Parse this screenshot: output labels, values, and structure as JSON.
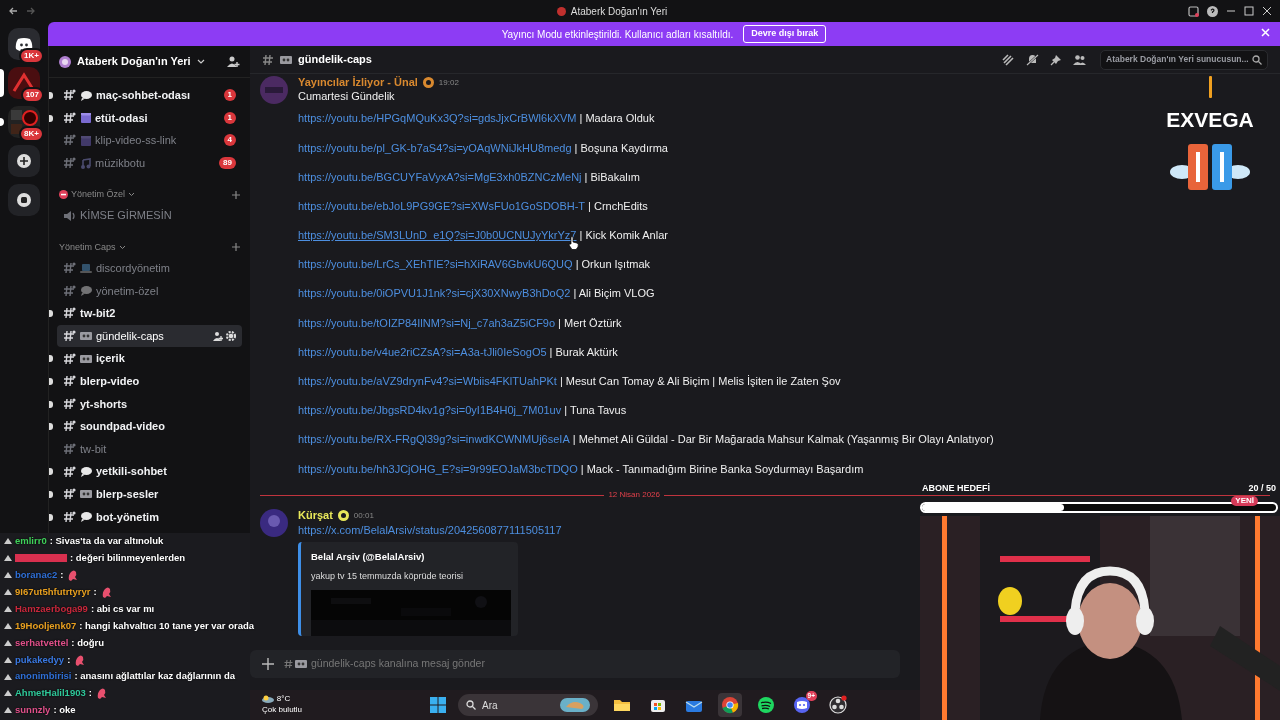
{
  "window": {
    "title": "Ataberk Doğan'ın Yeri"
  },
  "servers": [
    {
      "kind": "home",
      "badge": "1K+",
      "selected": false,
      "unread": false
    },
    {
      "kind": "server",
      "badge": "107",
      "selected": true
    },
    {
      "kind": "server",
      "badge": "8K+",
      "selected": false,
      "unread": true
    },
    {
      "kind": "add"
    },
    {
      "kind": "discover"
    }
  ],
  "banner": {
    "text": "Yayıncı Modu etkinleştirildi. Kullanıcı adları kısaltıldı.",
    "button": "Devre dışı bırak"
  },
  "server": {
    "name": "Ataberk Doğan'ın Yeri"
  },
  "channels": [
    {
      "kind": "text",
      "name": "maç-sohbet-odası",
      "unread": true,
      "selected": false,
      "badge": "1"
    },
    {
      "kind": "text",
      "name": "etüt-odasi",
      "unread": true,
      "selected": false,
      "badge": "1"
    },
    {
      "kind": "text",
      "name": "klip-video-ss-link",
      "unread": false,
      "selected": false,
      "badge": "4"
    },
    {
      "kind": "text",
      "name": "müzikbotu",
      "unread": false,
      "selected": false,
      "badge": "89"
    },
    {
      "kind": "category",
      "name": "Yönetim Özel"
    },
    {
      "kind": "voice",
      "name": "KİMSE GİRMESİN",
      "unread": false,
      "selected": false
    },
    {
      "kind": "category",
      "name": "Yönetim Caps"
    },
    {
      "kind": "text",
      "name": "discordyönetim",
      "unread": false,
      "selected": false
    },
    {
      "kind": "text",
      "name": "yönetim-özel",
      "unread": false,
      "selected": false
    },
    {
      "kind": "text",
      "name": "tw-bit2",
      "unread": true,
      "selected": false
    },
    {
      "kind": "text",
      "name": "gündelik-caps",
      "unread": false,
      "selected": true
    },
    {
      "kind": "text",
      "name": "içerik",
      "unread": true,
      "selected": false
    },
    {
      "kind": "text",
      "name": "blerp-video",
      "unread": true,
      "selected": false
    },
    {
      "kind": "text",
      "name": "yt-shorts",
      "unread": true,
      "selected": false
    },
    {
      "kind": "text",
      "name": "soundpad-video",
      "unread": true,
      "selected": false
    },
    {
      "kind": "text",
      "name": "tw-bit",
      "unread": false,
      "selected": false
    },
    {
      "kind": "text",
      "name": "yetkili-sohbet",
      "unread": true,
      "selected": false
    },
    {
      "kind": "text",
      "name": "blerp-sesler",
      "unread": true,
      "selected": false
    },
    {
      "kind": "text",
      "name": "bot-yönetim",
      "unread": true,
      "selected": false
    }
  ],
  "channel_header": {
    "name": "gündelik-caps",
    "search_placeholder": "Ataberk Doğan'ın Yeri sunucusun..."
  },
  "messages": [
    {
      "kind": "message",
      "author": "Yayıncılar İzliyor - Ünal",
      "color": "#d9892f",
      "time": "19:02",
      "text": "Cumartesi Gündelik",
      "links": [
        {
          "url": "https://youtu.be/HPGqMQuKx3Q?si=gdsJjxCrBWl6kXVM",
          "title": "| Madara Olduk",
          "hovered": false
        },
        {
          "url": "https://youtu.be/pl_GK-b7aS4?si=yOAqWNiJkHU8medg",
          "title": "| Boşuna Kaydırma",
          "hovered": false
        },
        {
          "url": "https://youtu.be/BGCUYFaVyxA?si=MgE3xh0BZNCzMeNj",
          "title": "| BiBakalım",
          "hovered": false
        },
        {
          "url": "https://youtu.be/ebJoL9PG9GE?si=XWsFUo1GoSDOBH-T",
          "title": "| CrnchEdits",
          "hovered": false
        },
        {
          "url": "https://youtu.be/SM3LUnD_e1Q?si=J0b0UCNUJyYkrYz7",
          "title": "| Kick Komik Anlar",
          "hovered": true
        },
        {
          "url": "https://youtu.be/LrCs_XEhTIE?si=hXiRAV6GbvkU6QUQ",
          "title": "| Orkun Işıtmak",
          "hovered": false
        },
        {
          "url": "https://youtu.be/0iOPVU1J1nk?si=cjX30XNwyB3hDoQ2",
          "title": "| Ali Biçim VLOG",
          "hovered": false
        },
        {
          "url": "https://youtu.be/tOIZP84IlNM?si=Nj_c7ah3aZ5iCF9o",
          "title": "| Mert Öztürk",
          "hovered": false
        },
        {
          "url": "https://youtu.be/v4ue2riCZsA?si=A3a-tJli0IeSogO5",
          "title": "| Burak Aktürk",
          "hovered": false
        },
        {
          "url": "https://youtu.be/aVZ9drynFv4?si=Wbiis4FKlTUahPKt",
          "title": "| Mesut Can Tomay & Ali Biçim | Melis İşiten ile Zaten Şov",
          "hovered": false
        },
        {
          "url": "https://youtu.be/JbgsRD4kv1g?si=0yI1B4H0j_7M01uv",
          "title": "| Tuna Tavus",
          "hovered": false
        },
        {
          "url": "https://youtu.be/RX-FRgQl39g?si=inwdKCWNMUj6seIA",
          "title": "| Mehmet Ali Güldal - Dar Bir Mağarada Mahsur Kalmak (Yaşanmış Bir Olayı Anlatıyor)",
          "hovered": false
        },
        {
          "url": "https://youtu.be/hh3JCjOHG_E?si=9r99EOJaM3bcTDQO",
          "title": "| Mack - Tanımadığım Birine Banka Soydurmayı Başardım",
          "hovered": false
        }
      ]
    },
    {
      "kind": "divider",
      "text": "12 Nisan 2026"
    },
    {
      "kind": "message",
      "author": "Kürşat",
      "color": "#e8e85a",
      "time": "00:01",
      "url": "https://x.com/BelalArsiv/status/2042560877111505117",
      "embed": {
        "author": "Belal Arşiv (@BelalArsiv)",
        "text": "yakup tv 15 temmuzda köprüde teorisi"
      }
    }
  ],
  "composer": {
    "placeholder": "gündelik-caps kanalına mesaj gönder"
  },
  "overlay_logo": {
    "text": "EXVEGA"
  },
  "sub_goal": {
    "label": "ABONE HEDEFİ",
    "count": "20 / 50",
    "level": 0.4,
    "tag": "YENİ"
  },
  "chat": [
    {
      "user": "emlirr0",
      "color": "#3fd15a",
      "text": ": Sivas'ta da var altınoluk"
    },
    {
      "color": "#d9304f",
      "text": ": değeri bilinmeyenlerden"
    },
    {
      "user": "boranac2",
      "color": "#2f6fd6",
      "text": ":",
      "emote": true
    },
    {
      "user": "9I67ut5hfutrtyryr",
      "color": "#e8a020",
      "text": ":",
      "emote": true
    },
    {
      "user": "Hamzaerboga99",
      "color": "#c8283c",
      "text": ": abi cs var mı"
    },
    {
      "user": "19Hooljenk07",
      "color": "#e8a020",
      "text": ": hangi kahvaltıcı 10 tane yer var orada"
    },
    {
      "user": "serhatvettel",
      "color": "#e0508a",
      "text": ": doğru"
    },
    {
      "user": "pukakedyy",
      "color": "#3a78e0",
      "text": ":",
      "emote": true
    },
    {
      "user": "anonimbirisi",
      "color": "#2f6fd6",
      "text": ": anasını ağlattılar kaz dağlarının da"
    },
    {
      "user": "AhmetHalil1903",
      "color": "#2fc89a",
      "text": ":",
      "emote": true
    },
    {
      "user": "sunnzly",
      "color": "#e0508a",
      "text": ": oke"
    }
  ],
  "taskbar": {
    "weather_temp": "8°C",
    "weather_desc": "Çok bulutlu",
    "search_placeholder": "Ara",
    "apps": [
      {
        "kind": "explorer",
        "selected": false
      },
      {
        "kind": "store",
        "selected": false
      },
      {
        "kind": "mail",
        "selected": false
      },
      {
        "kind": "chrome",
        "selected": true
      },
      {
        "kind": "spotify",
        "selected": false
      },
      {
        "kind": "discord",
        "selected": false,
        "badge": "9+"
      },
      {
        "kind": "obs",
        "selected": false
      }
    ]
  }
}
